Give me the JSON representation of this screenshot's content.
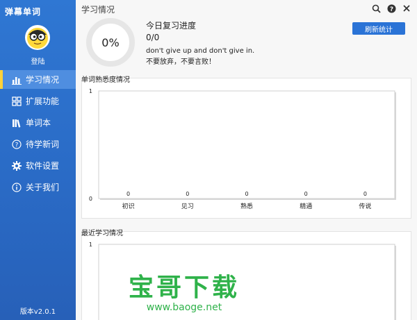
{
  "app": {
    "title": "弹幕单词"
  },
  "sidebar": {
    "login": "登陆",
    "items": [
      {
        "label": "学习情况",
        "icon": "bar-chart-icon",
        "active": true
      },
      {
        "label": "扩展功能",
        "icon": "grid-icon",
        "active": false
      },
      {
        "label": "单词本",
        "icon": "books-icon",
        "active": false
      },
      {
        "label": "待学新词",
        "icon": "question-icon",
        "active": false
      },
      {
        "label": "软件设置",
        "icon": "gear-icon",
        "active": false
      },
      {
        "label": "关于我们",
        "icon": "info-icon",
        "active": false
      }
    ],
    "version": "版本v2.0.1"
  },
  "main": {
    "title": "学习情况",
    "progress": {
      "percent_text": "0%",
      "percent": 0
    },
    "review_title": "今日复习进度",
    "review_count": "0/0",
    "motto_en": "don't give up and don't give in.",
    "motto_cn": "不要放弃，不要言败！",
    "refresh_button": "刷新统计"
  },
  "colors": {
    "sidebar": "#2a6bc6",
    "accent": "#2a73d6",
    "active_bar": "#ffd23a",
    "watermark": "#2fb24a"
  },
  "chart_data": [
    {
      "type": "bar",
      "title": "单词熟悉度情况",
      "categories": [
        "初识",
        "见习",
        "熟悉",
        "精通",
        "传说"
      ],
      "values": [
        0,
        0,
        0,
        0,
        0
      ],
      "ylim": [
        0,
        1
      ],
      "yticks": [
        0,
        1
      ],
      "grid": false
    },
    {
      "type": "line",
      "title": "最近学习情况",
      "ylim": [
        0,
        1
      ],
      "yticks": [
        1
      ]
    }
  ],
  "watermark": {
    "big": "宝哥下载",
    "small": "www.baoge.net"
  }
}
